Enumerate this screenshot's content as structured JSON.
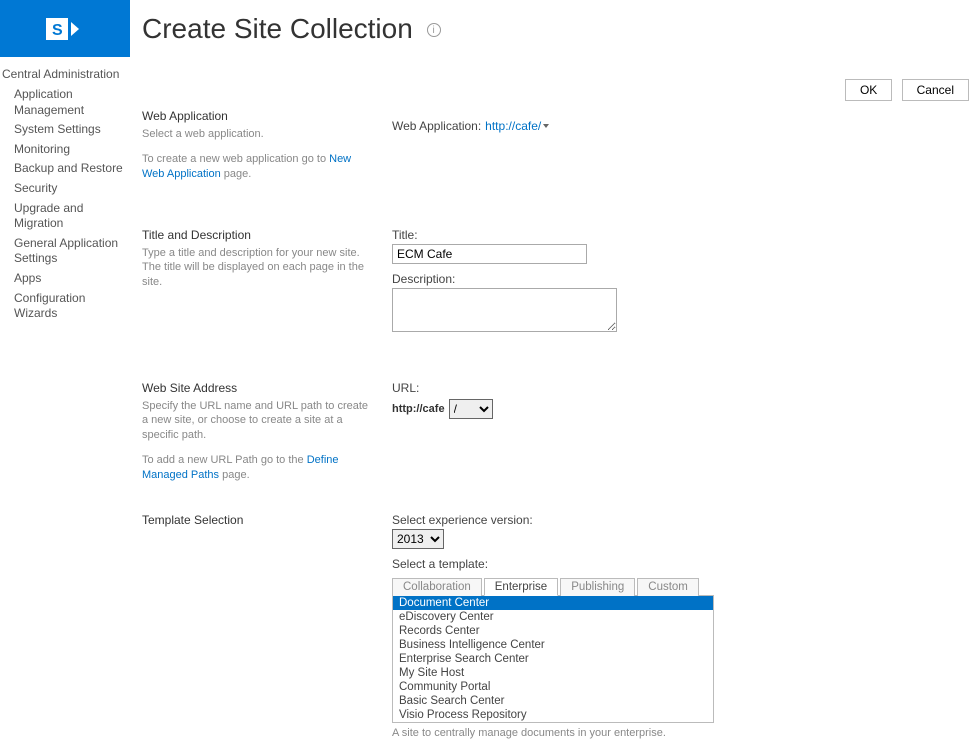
{
  "app": {
    "title": "Create Site Collection"
  },
  "buttons": {
    "ok": "OK",
    "cancel": "Cancel"
  },
  "sidebar": {
    "title": "Central Administration",
    "items": [
      "Application Management",
      "System Settings",
      "Monitoring",
      "Backup and Restore",
      "Security",
      "Upgrade and Migration",
      "General Application Settings",
      "Apps",
      "Configuration Wizards"
    ]
  },
  "sections": {
    "webapp": {
      "heading": "Web Application",
      "desc": "Select a web application.",
      "desc2_pre": "To create a new web application go to ",
      "desc2_link": "New Web Application",
      "desc2_post": " page.",
      "field_label": "Web Application:",
      "field_value": "http://cafe/"
    },
    "title_desc": {
      "heading": "Title and Description",
      "desc": "Type a title and description for your new site. The title will be displayed on each page in the site.",
      "title_label": "Title:",
      "title_value": "ECM Cafe",
      "description_label": "Description:",
      "description_value": ""
    },
    "url": {
      "heading": "Web Site Address",
      "desc": "Specify the URL name and URL path to create a new site, or choose to create a site at a specific path.",
      "desc2_pre": "To add a new URL Path go to the ",
      "desc2_link": "Define Managed Paths",
      "desc2_post": " page.",
      "url_label": "URL:",
      "url_base": "http://cafe",
      "url_path_options": [
        "/"
      ],
      "url_suffix": ""
    },
    "template": {
      "heading": "Template Selection",
      "version_label": "Select experience version:",
      "version_value": "2013",
      "select_label": "Select a template:",
      "tabs": [
        "Collaboration",
        "Enterprise",
        "Publishing",
        "Custom"
      ],
      "active_tab": "Enterprise",
      "templates": [
        "Document Center",
        "eDiscovery Center",
        "Records Center",
        "Business Intelligence Center",
        "Enterprise Search Center",
        "My Site Host",
        "Community Portal",
        "Basic Search Center",
        "Visio Process Repository"
      ],
      "selected_template": "Document Center",
      "template_desc": "A site to centrally manage documents in your enterprise."
    }
  }
}
